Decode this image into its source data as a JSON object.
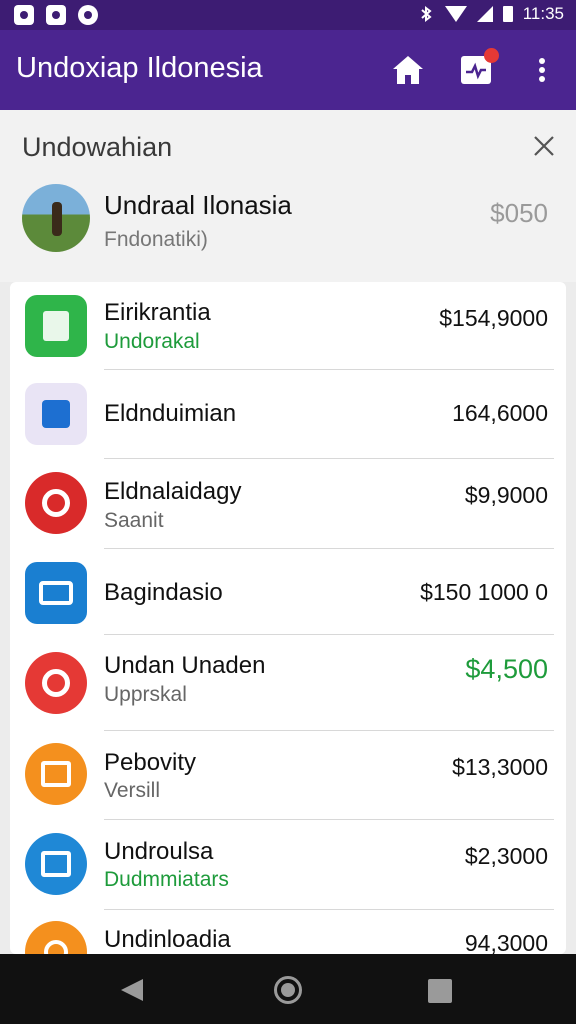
{
  "status_bar": {
    "time": "11:35",
    "icons": [
      "image-icon",
      "message-icon",
      "music-icon",
      "bluetooth-icon",
      "wifi-icon",
      "signal-icon",
      "battery-icon"
    ]
  },
  "app_bar": {
    "title": "Undoxiap Ildonesia",
    "icons": [
      "home-icon",
      "notification-icon",
      "more-vert-icon"
    ],
    "colors": {
      "status": "#3d1c73",
      "bar": "#4b2590",
      "badge": "#e53935"
    }
  },
  "header": {
    "title": "Undowahian",
    "close_icon": "close-icon",
    "profile": {
      "name": "Undraal Ilonasia",
      "subtitle": "Fndonatiki)",
      "amount": "$050"
    }
  },
  "transactions": [
    {
      "title": "Eirikrantia",
      "subtitle": "Undorakal",
      "amount": "$154,9000",
      "icon": "spreadsheet-icon",
      "color": "#2fb54a"
    },
    {
      "title": "Eldnduimian",
      "subtitle": "",
      "amount": "164,6000",
      "icon": "calendar-icon",
      "color": "#e9e4f5"
    },
    {
      "title": "Eldnalaidagy",
      "subtitle": "Saanit",
      "amount": "$9,9000",
      "icon": "recording-icon",
      "color": "#d92a2a"
    },
    {
      "title": "Bagindasio",
      "subtitle": "",
      "amount": "$150 1000 0",
      "icon": "camera-icon",
      "color": "#1a7fd1"
    },
    {
      "title": "Undan Unaden",
      "subtitle": "Upprskal",
      "amount": "$4,500",
      "icon": "chart-icon",
      "color": "#e53935"
    },
    {
      "title": "Pebovity",
      "subtitle": "Versill",
      "amount": "$13,3000",
      "icon": "tv-icon",
      "color": "#f4901e"
    },
    {
      "title": "Undroulsa",
      "subtitle": "Dudmmiatars",
      "amount": "$2,3000",
      "icon": "document-icon",
      "color": "#1f88d6"
    },
    {
      "title": "Undinloadia",
      "subtitle": "",
      "amount": "94,3000",
      "icon": "edit-icon",
      "color": "#f4901e"
    }
  ],
  "nav_bar": {
    "icons": [
      "back-icon",
      "home-circle-icon",
      "recents-icon"
    ]
  }
}
